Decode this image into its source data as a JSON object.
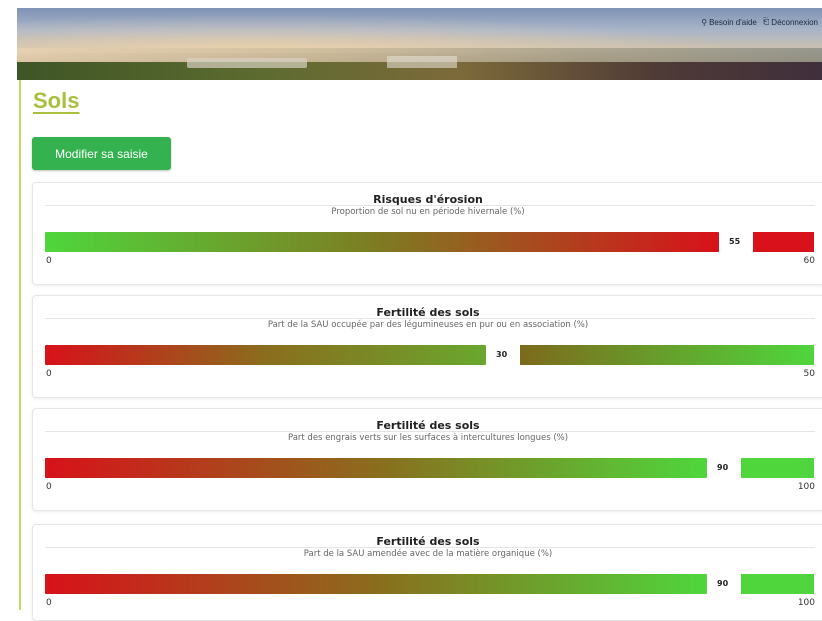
{
  "header": {
    "help_label": "Besoin d'aide",
    "logout_label": "Déconnexion"
  },
  "page": {
    "title": "Sols",
    "edit_button": "Modifier sa saisie"
  },
  "indicators": [
    {
      "title": "Risques d'érosion",
      "subtitle": "Proportion de sol nu en période hivernale (%)",
      "value": "55",
      "min": "0",
      "max": "60",
      "direction": "green-to-red",
      "fraction": 0.917
    },
    {
      "title": "Fertilité des sols",
      "subtitle": "Part de la SAU occupée par des légumineuses en pur ou en association (%)",
      "value": "30",
      "min": "0",
      "max": "50",
      "direction": "red-to-green",
      "fraction": 0.6
    },
    {
      "title": "Fertilité des sols",
      "subtitle": "Part des engrais verts sur les surfaces à intercultures longues (%)",
      "value": "90",
      "min": "0",
      "max": "100",
      "direction": "red-to-green",
      "fraction": 0.9
    },
    {
      "title": "Fertilité des sols",
      "subtitle": "Part de la SAU amendée avec de la matière organique (%)",
      "value": "90",
      "min": "0",
      "max": "100",
      "direction": "red-to-green",
      "fraction": 0.9
    }
  ],
  "colors": {
    "accent": "#a9bf3d",
    "button": "#34b24f",
    "good": "#4fd63c",
    "bad": "#d8111a"
  }
}
